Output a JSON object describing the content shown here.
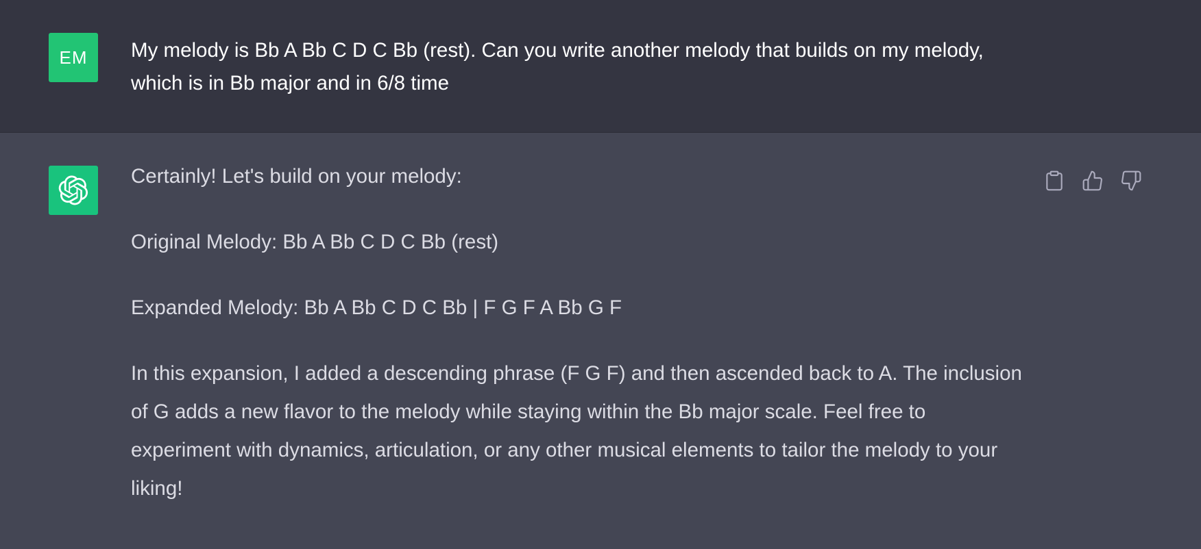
{
  "conversation": {
    "user": {
      "avatar_initials": "EM",
      "message": "My melody is Bb A Bb C D C Bb (rest). Can you write another melody that builds on my melody, which is in Bb major and in 6/8 time"
    },
    "assistant": {
      "avatar_icon": "openai-logo-icon",
      "paragraphs": [
        "Certainly! Let's build on your melody:",
        "Original Melody: Bb A Bb C D C Bb (rest)",
        "Expanded Melody: Bb A Bb C D C Bb | F G F A Bb G F",
        "In this expansion, I added a descending phrase (F G F) and then ascended back to A. The inclusion of G adds a new flavor to the melody while staying within the Bb major scale. Feel free to experiment with dynamics, articulation, or any other musical elements to tailor the melody to your liking!"
      ],
      "actions": [
        "copy-icon",
        "thumbs-up-icon",
        "thumbs-down-icon"
      ]
    }
  },
  "colors": {
    "user_bg": "#343541",
    "assistant_bg": "#444654",
    "avatar_green": "#19c37d",
    "icon_gray": "#acacbe"
  }
}
